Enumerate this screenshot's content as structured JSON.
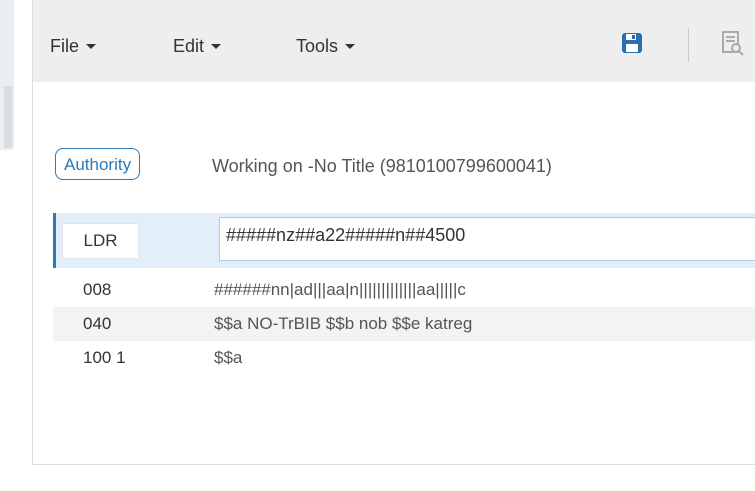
{
  "menu": {
    "file": "File",
    "edit": "Edit",
    "tools": "Tools"
  },
  "toolbar": {
    "save_icon": "save-icon",
    "preview_icon": "record-preview-icon"
  },
  "header": {
    "badge": "Authority",
    "working_on": "Working on -No Title (9810100799600041)"
  },
  "record": {
    "leader": {
      "tag": "LDR",
      "value": "#####nz##a22#####n##4500"
    },
    "fields": [
      {
        "tag": "008",
        "value": "######nn|ad|||aa|n|||||||||||||aa|||||c"
      },
      {
        "tag": "040",
        "value": "$$a NO-TrBIB $$b nob $$e katreg"
      },
      {
        "tag": "100 1",
        "value": "$$a"
      }
    ]
  },
  "colors": {
    "accent": "#2a7ab9",
    "toolbar_bg": "#eeeeee",
    "selected_row": "#e3eefb"
  }
}
